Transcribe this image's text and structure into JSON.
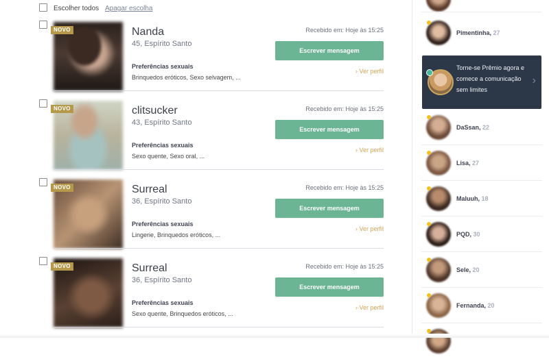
{
  "toolbar": {
    "select_all": "Escolher todos",
    "clear_selection": "Apagar escolha"
  },
  "cards": [
    {
      "badge": "NOVO",
      "name": "Nanda",
      "location": "45, Espírito Santo",
      "prefs_title": "Preferências sexuais",
      "prefs": "Brinquedos eróticos, Sexo selvagem, ...",
      "received": "Recebido em: Hoje às 15:25",
      "button": "Escrever mensagem",
      "profile_link": "Ver perfil"
    },
    {
      "badge": "NOVO",
      "name": "clitsucker",
      "location": "43, Espírito Santo",
      "prefs_title": "Preferências sexuais",
      "prefs": "Sexo quente, Sexo oral, ...",
      "received": "Recebido em: Hoje às 15:25",
      "button": "Escrever mensagem",
      "profile_link": "Ver perfil"
    },
    {
      "badge": "NOVO",
      "name": "Surreal",
      "location": "36, Espírito Santo",
      "prefs_title": "Preferências sexuais",
      "prefs": "Lingerie, Brinquedos eróticos, ...",
      "received": "Recebido em: Hoje às 15:25",
      "button": "Escrever mensagem",
      "profile_link": "Ver perfil"
    },
    {
      "badge": "NOVO",
      "name": "Surreal",
      "location": "36, Espírito Santo",
      "prefs_title": "Preferências sexuais",
      "prefs": "Sexo quente, Brinquedos eróticos, ...",
      "received": "Recebido em: Hoje às 15:25",
      "button": "Escrever mensagem",
      "profile_link": "Ver perfil"
    }
  ],
  "premium": {
    "text": "Torne-se Prêmio agora e comece a comunicação sem limites"
  },
  "sidebar": [
    {
      "name": "Pimentinha",
      "age": "27"
    },
    {
      "name": "DaSsan",
      "age": "22"
    },
    {
      "name": "Lisa",
      "age": "27"
    },
    {
      "name": "Maluuh",
      "age": "18"
    },
    {
      "name": "PQD",
      "age": "30"
    },
    {
      "name": "Sele",
      "age": "20"
    },
    {
      "name": "Fernanda",
      "age": "20"
    }
  ],
  "colors": {
    "button": "#6bb594",
    "badge": "#b5984a",
    "link": "#d4a455",
    "premium_bg": "#2c3848",
    "online": "#f2c11c"
  }
}
